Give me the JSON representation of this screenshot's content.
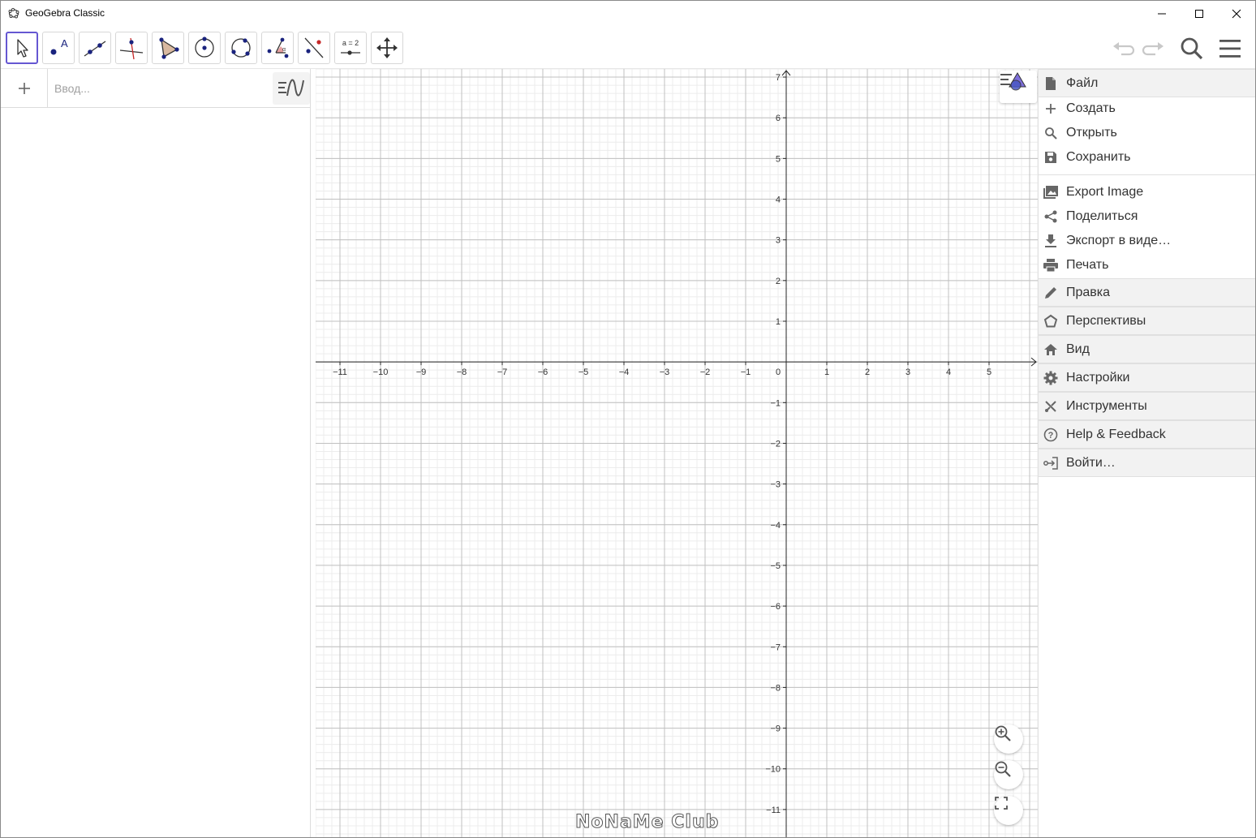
{
  "window": {
    "title": "GeoGebra Classic"
  },
  "toolbar": {
    "tools": [
      {
        "name": "move-tool",
        "label": ""
      },
      {
        "name": "point-tool",
        "label": ""
      },
      {
        "name": "line-tool",
        "label": ""
      },
      {
        "name": "perpendicular-line-tool",
        "label": ""
      },
      {
        "name": "polygon-tool",
        "label": ""
      },
      {
        "name": "circle-center-point-tool",
        "label": ""
      },
      {
        "name": "circle-three-points-tool",
        "label": ""
      },
      {
        "name": "angle-tool",
        "label": ""
      },
      {
        "name": "reflect-tool",
        "label": ""
      },
      {
        "name": "slider-tool",
        "label": "a = 2"
      },
      {
        "name": "move-graphics-tool",
        "label": ""
      }
    ],
    "selected": "move-tool",
    "right_icons": [
      "undo-icon",
      "redo-icon",
      "search-icon",
      "menu-icon"
    ]
  },
  "algebra": {
    "input_placeholder": "Ввод..."
  },
  "graphics": {
    "x_axis_ticks": [
      "−11",
      "−10",
      "−9",
      "−8",
      "−7",
      "−6",
      "−5",
      "−4",
      "−3",
      "−2",
      "−1",
      "0",
      "1",
      "2",
      "3",
      "4",
      "5"
    ],
    "y_axis_ticks_positive": [
      "1",
      "2",
      "3",
      "4",
      "5",
      "6",
      "7"
    ],
    "y_axis_ticks_negative": [
      "−1",
      "−2",
      "−3",
      "−4",
      "−5",
      "−6",
      "−7",
      "−8",
      "−9",
      "−10",
      "−11"
    ],
    "x_range": [
      -11.6,
      6.2
    ],
    "y_range": [
      -11.7,
      7.2
    ],
    "zoom_buttons": [
      "zoom-in-icon",
      "zoom-out-icon",
      "fullscreen-icon"
    ],
    "watermark": "NoNaMe Club"
  },
  "menu": {
    "file_header": "Файл",
    "file_items": [
      {
        "label": "Создать",
        "icon": "plus-icon"
      },
      {
        "label": "Открыть",
        "icon": "search-icon"
      },
      {
        "label": "Сохранить",
        "icon": "save-icon"
      },
      {
        "label": "Export Image",
        "icon": "image-icon"
      },
      {
        "label": "Поделиться",
        "icon": "share-icon"
      },
      {
        "label": "Экспорт в виде…",
        "icon": "download-icon"
      },
      {
        "label": "Печать",
        "icon": "print-icon"
      }
    ],
    "sections": [
      {
        "label": "Правка",
        "icon": "pencil-icon"
      },
      {
        "label": "Перспективы",
        "icon": "pentagon-icon"
      },
      {
        "label": "Вид",
        "icon": "home-icon"
      },
      {
        "label": "Настройки",
        "icon": "gear-icon"
      },
      {
        "label": "Инструменты",
        "icon": "tools-icon"
      },
      {
        "label": "Help & Feedback",
        "icon": "help-icon"
      },
      {
        "label": "Войти…",
        "icon": "sign-in-icon"
      }
    ]
  },
  "colors": {
    "accent": "#6557d2",
    "point": "#1565c0",
    "polygon_fill": "#d9b9a0",
    "axis": "#252525",
    "grid_major": "#c0c0c0",
    "grid_minor": "#ececec"
  }
}
